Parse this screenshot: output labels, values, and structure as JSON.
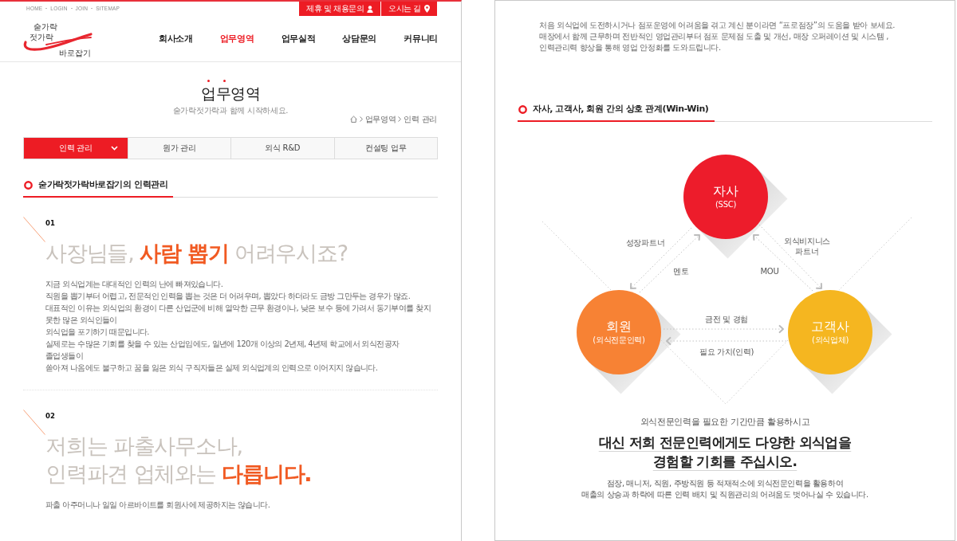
{
  "left_page": {
    "top_links": [
      "HOME",
      "LOGIN",
      "JOIN",
      "SITEMAP"
    ],
    "top_buttons": [
      {
        "label": "제휴 및 채용문의",
        "kind": "person"
      },
      {
        "label": "오시는 길",
        "kind": "pin"
      }
    ],
    "logo": {
      "lines": [
        "숟가락",
        "젓가락",
        "바로잡기"
      ]
    },
    "nav": [
      {
        "label": "회사소개",
        "selected": false
      },
      {
        "label": "업무영역",
        "selected": true
      },
      {
        "label": "업무실적",
        "selected": false
      },
      {
        "label": "상담문의",
        "selected": false
      },
      {
        "label": "커뮤니티",
        "selected": false
      }
    ],
    "page_title": "업무영역",
    "page_subtitle": "숟가락젓가락과 함께 시작하세요.",
    "breadcrumb": [
      "업무영역",
      "인력 관리"
    ],
    "tabs": [
      {
        "label": "인력 관리",
        "selected": true
      },
      {
        "label": "원가 관리",
        "selected": false
      },
      {
        "label": "외식 R&D",
        "selected": false
      },
      {
        "label": "컨설팅 업무",
        "selected": false
      }
    ],
    "section_title": "숟가락젓가락바로잡기의 인력관리",
    "items": [
      {
        "number": "01",
        "headline_lines": [
          "사장님들, **사람 뽑기** 어려우시죠?"
        ],
        "body_lines": [
          "지금 외식업계는 대대적인 인력의 난에 빠져있습니다.",
          "직원을 뽑기부터 어렵고, 전문적인 인력을 뽑는 것은 더 어려우며, 뽑았다 하더라도 금방 그만두는 경우가 많죠.",
          "대표적인 이유는 외식업의 환경이 다른 산업군에 비해 열악한 근무 환경이나, 낮은 보수 등에 가려서 동기부여를 찾지 못한 많은 외식인들이",
          "외식업을 포기하기 때문입니다.",
          "실제로는 수많은 기회를 찾을 수 있는 산업임에도, 일년에 120개 이상의 2년제, 4년제 학교에서 외식전공자 졸업생들이",
          "쏟아져 나옴에도 불구하고 꿈을 잃은 외식 구직자들은 실제 외식업계의 인력으로 이어지지 않습니다."
        ]
      },
      {
        "number": "02",
        "headline_lines": [
          "저희는 파출사무소나,",
          "인력파견 업체와는 **다릅니다.**"
        ],
        "body_lines": [
          "파출 아주머니나 일일 아르바이트를 회원사에 제공하지는 않습니다."
        ]
      }
    ]
  },
  "right_page": {
    "intro_lines": [
      "처음 외식업에 도전하시거나 점포운영에 어려움을 겪고 계신 분이라면 “프로점장”의 도움을 받아 보세요.",
      "매장에서 함께 근무하며 전반적인 영업관리부터 점포 문제점 도출 및 개선, 매장 오퍼레이션 및 시스템 ,",
      "인력관리력 향상을 통해 영업 안정화를 도와드립니다."
    ],
    "section_title": "자사, 고객사, 회원 간의 상호 관계(Win-Win)",
    "diagram": {
      "nodes": [
        {
          "title": "자사",
          "subtitle": "(SSC)",
          "color": "#ed1c2b"
        },
        {
          "title": "회원",
          "subtitle": "(외식전문인력)",
          "color": "#f78234"
        },
        {
          "title": "고객사",
          "subtitle": "(외식업체)",
          "color": "#f5b620"
        }
      ],
      "relations": [
        {
          "label_lines": [
            "성장파트너"
          ]
        },
        {
          "label_lines": [
            "멘토"
          ]
        },
        {
          "label_lines": [
            "외식비지니스",
            "파트너"
          ]
        },
        {
          "label_lines": [
            "MOU"
          ]
        },
        {
          "label_lines": [
            "금전 및 경험"
          ]
        },
        {
          "label_lines": [
            "필요 가치(인력)"
          ]
        }
      ]
    },
    "lead": "외식전문인력을 필요한 기간만큼 활용하시고",
    "headline_lines": [
      "대신 저희 전문인력에게도 다양한 외식업을",
      "경험할 기회를 주십시오."
    ],
    "note_lines": [
      "점장, 매니저, 직원, 주방직원 등 적재적소에 외식전문인력을 활용하여",
      "매출의 상승과 하락에 따른 인력 배치 및 직원관리의 어려움도 벗어나실 수 있습니다."
    ]
  }
}
